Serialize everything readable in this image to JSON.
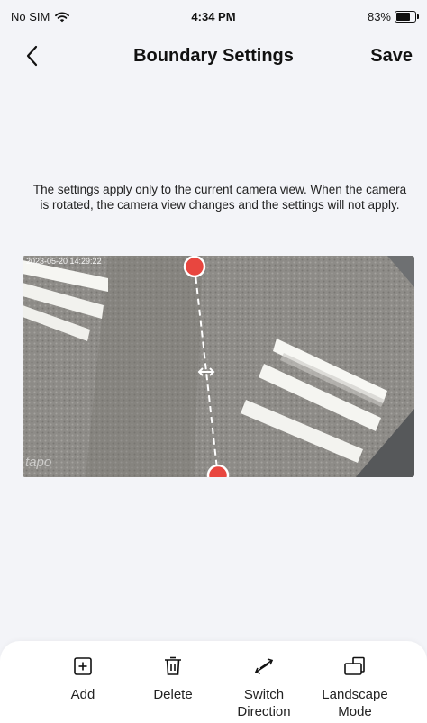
{
  "status_bar": {
    "carrier": "No SIM",
    "time": "4:34 PM",
    "battery_text": "83%",
    "battery_level": 0.83
  },
  "nav": {
    "title": "Boundary Settings",
    "save_label": "Save"
  },
  "info": {
    "message": "The settings apply only to the current camera view. When the camera is rotated, the camera view changes and the settings will not apply."
  },
  "camera": {
    "timestamp": "2023-05-20 14:29:22",
    "watermark": "tapo"
  },
  "toolbar": {
    "items": [
      {
        "icon": "add-square-icon",
        "label": "Add"
      },
      {
        "icon": "trash-icon",
        "label": "Delete"
      },
      {
        "icon": "switch-arrows-icon",
        "label": "Switch\nDirection"
      },
      {
        "icon": "landscape-rotate-icon",
        "label": "Landscape\nMode"
      }
    ]
  },
  "colors": {
    "background": "#f3f4f8",
    "handle": "#e8463f",
    "toolbar_bg": "#ffffff"
  }
}
